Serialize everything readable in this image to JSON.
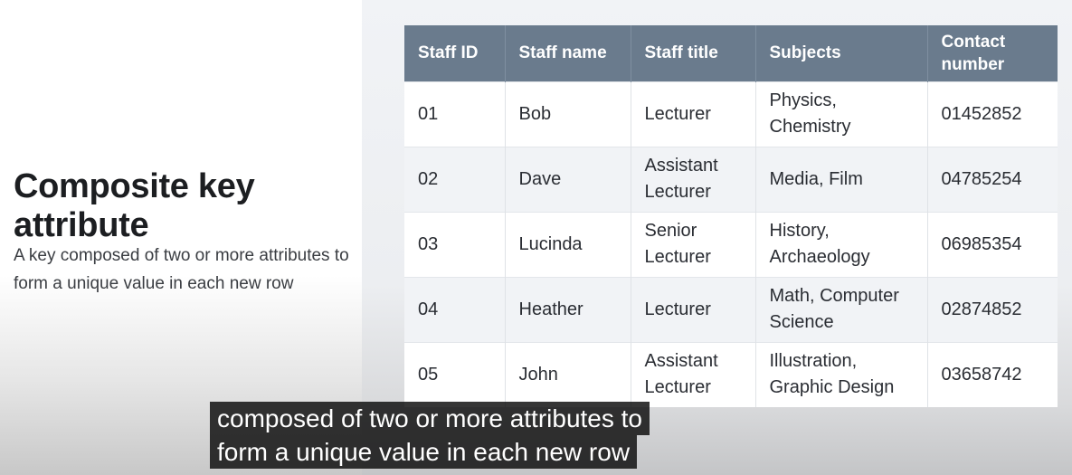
{
  "slide": {
    "title": "Composite key attribute",
    "description": "A key composed of two or more attributes to form a unique value in each new row"
  },
  "table": {
    "headers": [
      "Staff ID",
      "Staff name",
      "Staff title",
      "Subjects",
      "Contact number"
    ],
    "rows": [
      [
        "01",
        "Bob",
        "Lecturer",
        "Physics, Chemistry",
        "01452852"
      ],
      [
        "02",
        "Dave",
        "Assistant Lecturer",
        "Media, Film",
        "04785254"
      ],
      [
        "03",
        "Lucinda",
        "Senior Lecturer",
        "History, Archaeology",
        "06985354"
      ],
      [
        "04",
        "Heather",
        "Lecturer",
        "Math, Computer Science",
        "02874852"
      ],
      [
        "05",
        "John",
        "Assistant Lecturer",
        "Illustration, Graphic Design",
        "03658742"
      ]
    ]
  },
  "subtitle": {
    "line1": "composed of two or more attributes to",
    "line2": "form a unique value in each new row"
  }
}
